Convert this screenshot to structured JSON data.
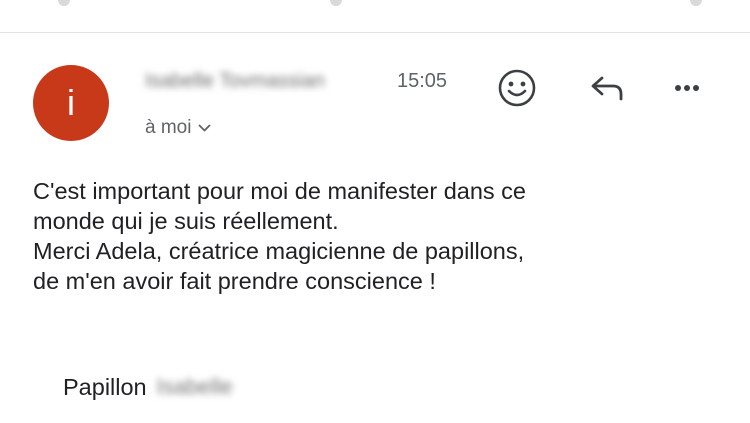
{
  "message": {
    "avatar_letter": "i",
    "avatar_color": "#c8391a",
    "sender_name": "Isabelle Tovmassian",
    "time": "15:05",
    "recipient_label": "à moi",
    "actions": {
      "emoji_icon": "smiley-face-icon",
      "reply_icon": "reply-arrow-icon",
      "more_icon": "more-horizontal-icon"
    },
    "body": {
      "line1": "C'est important pour moi de manifester dans ce",
      "line2": "monde qui je suis réellement.",
      "line3": "Merci Adela, créatrice magicienne de papillons,",
      "line4": "de m'en avoir fait prendre conscience !"
    },
    "signature": {
      "word": "Papillon",
      "name": "Isabelle"
    }
  }
}
